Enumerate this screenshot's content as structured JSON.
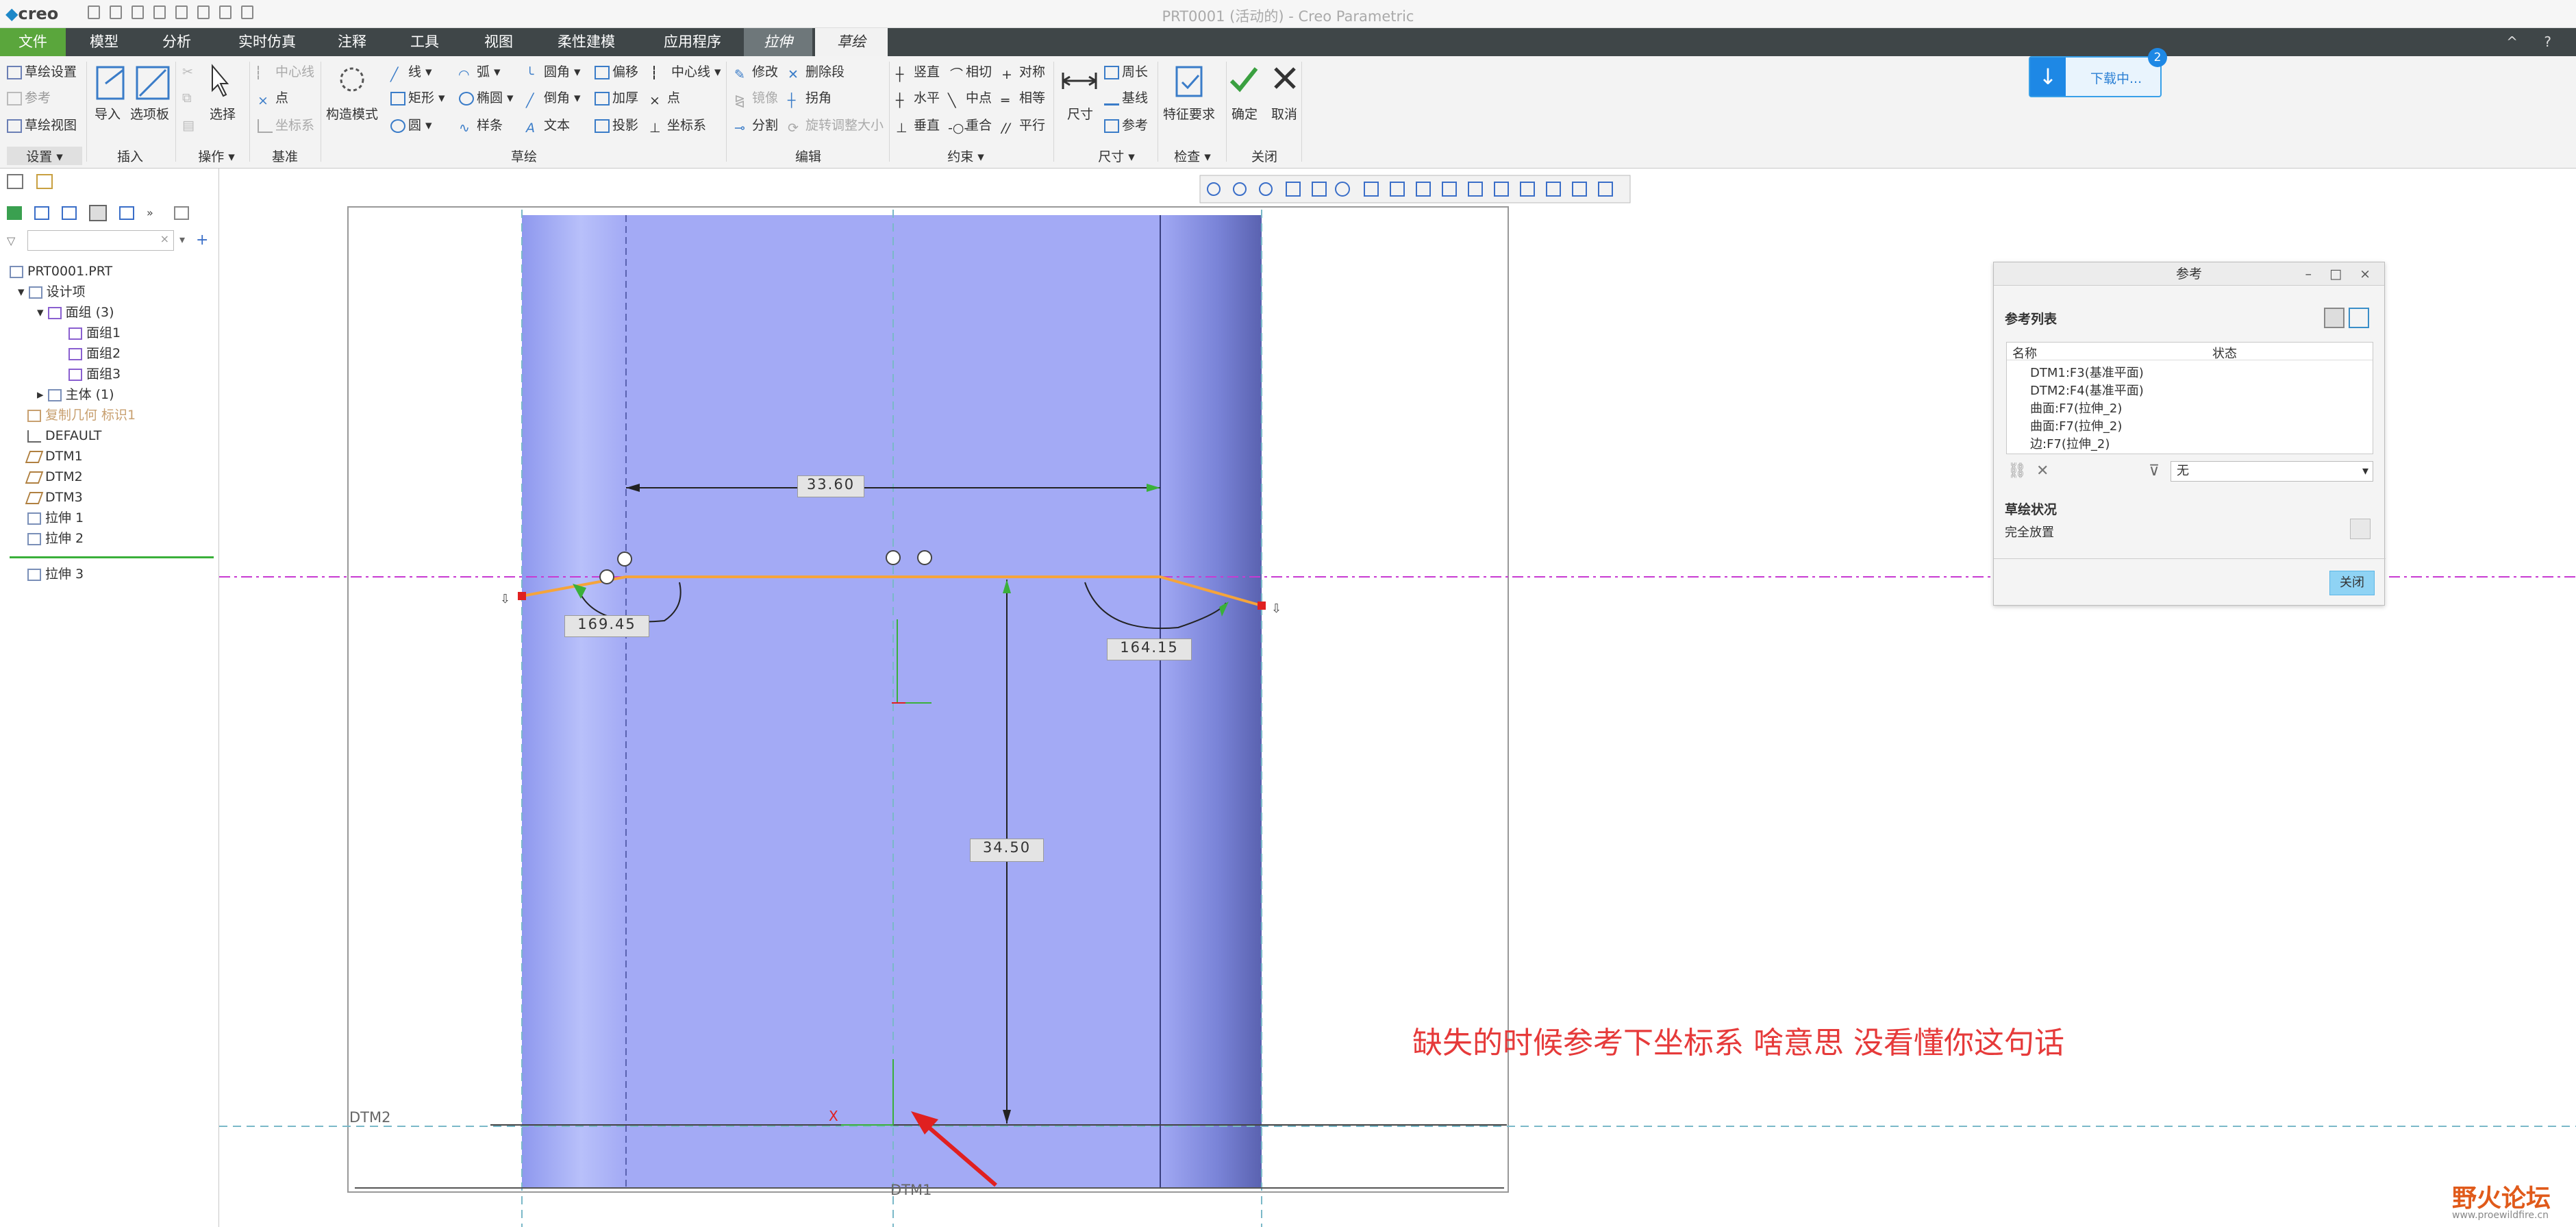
{
  "app": {
    "logo": "creo",
    "window_title": "PRT0001 (活动的) - Creo Parametric"
  },
  "tabs": {
    "file": "文件",
    "model": "模型",
    "analysis": "分析",
    "simulation": "实时仿真",
    "annotate": "注释",
    "tools": "工具",
    "view": "视图",
    "flexible": "柔性建模",
    "apps": "应用程序",
    "extrude": "拉伸",
    "sketch": "草绘"
  },
  "ribbon": {
    "setup": {
      "sketch_setup": "草绘设置",
      "ref": "参考",
      "sketch_view": "草绘视图",
      "label": "设置 ▾"
    },
    "insert": {
      "import": "导入",
      "palette": "选项板",
      "label": "插入"
    },
    "operations": {
      "select": "选择",
      "label": "操作 ▾"
    },
    "datum": {
      "centerline": "中心线",
      "point": "点",
      "csys": "坐标系",
      "label": "基准"
    },
    "sketch": {
      "construction": "构造模式",
      "line": "线",
      "arc": "弧",
      "fillet": "圆角",
      "offset": "偏移",
      "centerline": "中心线",
      "rectangle": "矩形",
      "ellipse": "椭圆",
      "chamfer": "倒角",
      "thicken": "加厚",
      "point": "点",
      "circle": "圆",
      "spline": "样条",
      "text": "文本",
      "project": "投影",
      "csys": "坐标系",
      "label": "草绘"
    },
    "edit": {
      "modify": "修改",
      "delete_segment": "删除段",
      "mirror": "镜像",
      "corner": "拐角",
      "divide": "分割",
      "rotate_resize": "旋转调整大小",
      "label": "编辑"
    },
    "constrain": {
      "vertical": "竖直",
      "tangent": "相切",
      "symmetric": "对称",
      "horizontal": "水平",
      "midpoint": "中点",
      "equal": "相等",
      "perpendicular": "垂直",
      "coincident": "重合",
      "parallel": "平行",
      "label": "约束 ▾"
    },
    "dimension": {
      "dimension": "尺寸",
      "perimeter": "周长",
      "baseline": "基线",
      "reference": "参考",
      "label": "尺寸 ▾"
    },
    "inspect": {
      "feature_req": "特征要求",
      "label": "检查 ▾"
    },
    "close": {
      "ok": "确定",
      "cancel": "取消",
      "label": "关闭"
    }
  },
  "download": {
    "text": "下载中...",
    "count": "2"
  },
  "model_tree": {
    "items": [
      {
        "label": "PRT0001.PRT"
      },
      {
        "label": "设计项"
      },
      {
        "label": "面组 (3)"
      },
      {
        "label": "面组1"
      },
      {
        "label": "面组2"
      },
      {
        "label": "面组3"
      },
      {
        "label": "主体 (1)"
      },
      {
        "label": "复制几何 标识1"
      },
      {
        "label": "DEFAULT"
      },
      {
        "label": "DTM1"
      },
      {
        "label": "DTM2"
      },
      {
        "label": "DTM3"
      },
      {
        "label": "拉伸 1"
      },
      {
        "label": "拉伸 2"
      },
      {
        "label": "拉伸 3"
      }
    ]
  },
  "canvas": {
    "dims": {
      "width": "33.60",
      "angle_left": "169.45",
      "angle_right": "164.15",
      "height": "34.50"
    },
    "labels": {
      "dtm2": "DTM2",
      "dtm1": "DTM1",
      "x": "X"
    },
    "annotation": "缺失的时候参考下坐标系   啥意思  没看懂你这句话"
  },
  "ref_dialog": {
    "title": "参考",
    "list_label": "参考列表",
    "col_name": "名称",
    "col_status": "状态",
    "items": [
      "DTM1:F3(基准平面)",
      "DTM2:F4(基准平面)",
      "曲面:F7(拉伸_2)",
      "曲面:F7(拉伸_2)",
      "边:F7(拉伸_2)"
    ],
    "filter_value": "无",
    "status_label": "草绘状况",
    "status_value": "完全放置",
    "close_button": "关闭"
  },
  "watermark": {
    "text": "野火论坛",
    "url": "www.proewildfire.cn"
  },
  "colors": {
    "tabbar": "#3f4648",
    "file_tab": "#5aa63c",
    "part": "#a3aaf5",
    "sketch_line": "#f5a43b",
    "annotation": "#e63a3a"
  }
}
